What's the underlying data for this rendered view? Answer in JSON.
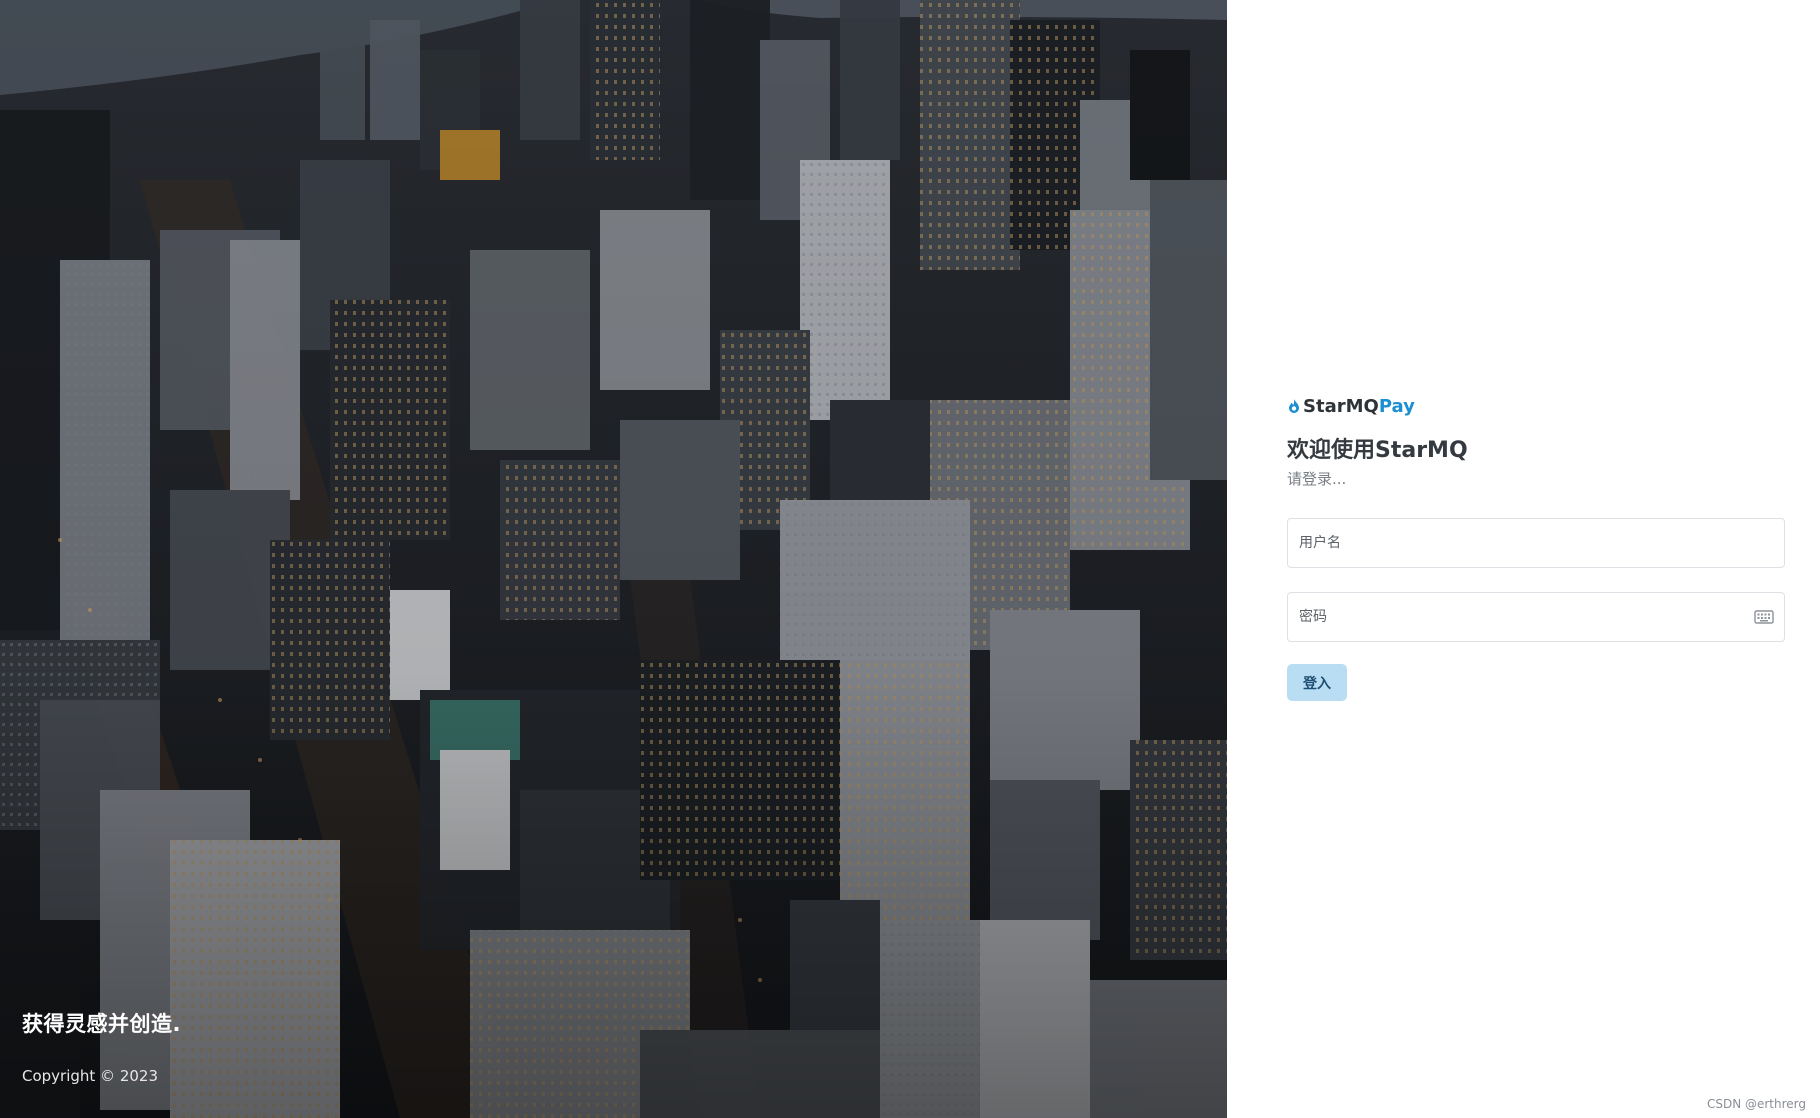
{
  "hero": {
    "image": "aerial-city-skyline-at-dusk",
    "tagline": "获得灵感并创造.",
    "copyright": "Copyright © 2023"
  },
  "brand": {
    "icon": "flame-icon",
    "name_part1": "StarMQ",
    "name_part2": "Pay",
    "accent_color": "#1c8fd1"
  },
  "login": {
    "welcome": "欢迎使用StarMQ",
    "subtitle": "请登录...",
    "username": {
      "value": "",
      "placeholder": "用户名"
    },
    "password": {
      "value": "",
      "placeholder": "密码",
      "icon": "keyboard-icon"
    },
    "submit_label": "登入",
    "submit_color": "#b9ddf2"
  },
  "watermark": "CSDN @erthrerg"
}
